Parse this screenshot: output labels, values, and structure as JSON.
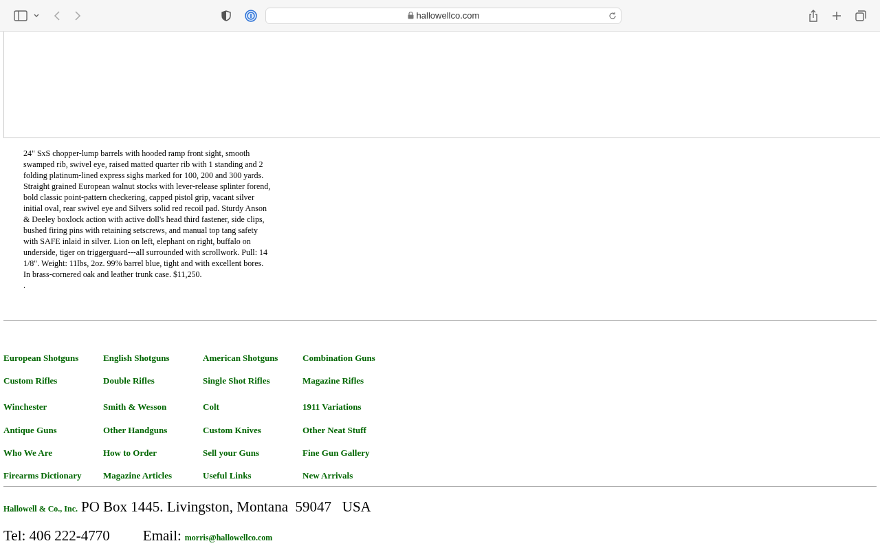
{
  "browser": {
    "url": "hallowellco.com"
  },
  "description": {
    "text": "24\" SxS chopper-lump barrels with hooded ramp front sight, smooth swamped rib, swivel eye, raised matted quarter rib with 1 standing and 2 folding platinum-lined express sighs marked for 100, 200 and 300 yards. Straight grained European walnut stocks with lever-release splinter forend, bold classic point-pattern checkering, capped pistol grip, vacant silver initial oval, rear swivel eye and Silvers solid red recoil pad. Sturdy Anson & Deeley boxlock action with active doll's head third fastener, side clips, bushed firing pins with retaining setscrews, and manual top tang safety with SAFE inlaid in silver. Lion on left, elephant on right, buffalo on underside, tiger on triggerguard---all surrounded with scrollwork. Pull: 14 1/8\". Weight: 11lbs, 2oz. 99% barrel blue, tight and with excellent bores. In brass-cornered oak and leather trunk case.  $11,250.",
    "trailing": "."
  },
  "nav_rows": [
    [
      "European Shotguns",
      "English Shotguns",
      "American Shotguns",
      "Combination Guns"
    ],
    [
      "Custom Rifles",
      "Double Rifles",
      "Single Shot Rifles",
      "Magazine Rifles"
    ],
    [
      "Winchester",
      "Smith & Wesson",
      "Colt",
      "1911 Variations"
    ],
    [
      "Antique Guns",
      "Other Handguns",
      "Custom Knives",
      "Other Neat Stuff"
    ],
    [
      "Who We Are",
      "How to Order",
      "Sell your Guns",
      "Fine Gun Gallery"
    ],
    [
      "Firearms Dictionary",
      "Magazine Articles",
      "Useful Links",
      "New Arrivals"
    ]
  ],
  "footer": {
    "company": "Hallowell & Co., Inc.",
    "address": "PO Box 1445. Livingston, Montana  59047   USA",
    "tel": "Tel: 406 222-4770",
    "email_label": "Email:",
    "email": "morris@hallowellco.com"
  }
}
